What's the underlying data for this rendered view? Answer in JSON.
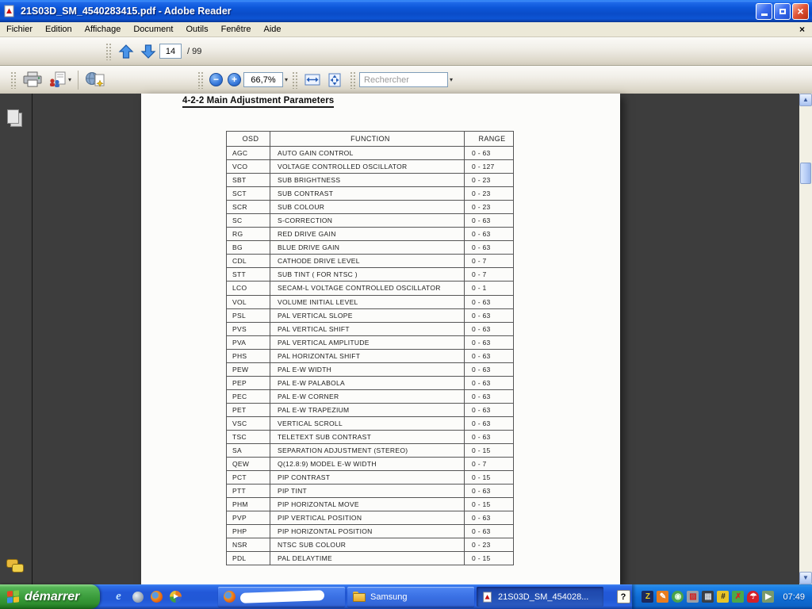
{
  "window": {
    "title": "21S03D_SM_4540283415.pdf - Adobe Reader"
  },
  "menu": {
    "items": [
      "Fichier",
      "Edition",
      "Affichage",
      "Document",
      "Outils",
      "Fenêtre",
      "Aide"
    ]
  },
  "toolbar": {
    "page_number": "14",
    "page_count_label": "/ 99",
    "zoom_level": "66,7%",
    "search_placeholder": "Rechercher"
  },
  "icons": {
    "titlebar": [
      "adobe-reader",
      "minimize",
      "restore",
      "close"
    ],
    "toolbar": [
      "page-up",
      "page-down",
      "print",
      "email-share",
      "create-pdf-online",
      "zoom-out",
      "zoom-in",
      "fit-width",
      "fit-page",
      "search"
    ],
    "nav_panel": [
      "pages",
      "comments"
    ],
    "quick_launch": [
      "internet-explorer",
      "messenger",
      "firefox",
      "media-player"
    ],
    "tray": [
      "zonealarm",
      "writing-tool",
      "badge",
      "shield",
      "display",
      "utility",
      "network-users",
      "avira-antivirus",
      "pointer"
    ]
  },
  "document": {
    "section_title": "4-2-2 Main Adjustment Parameters",
    "table": {
      "headers": [
        "OSD",
        "FUNCTION",
        "RANGE"
      ],
      "rows": [
        [
          "AGC",
          "AUTO GAIN CONTROL",
          "0 - 63"
        ],
        [
          "VCO",
          "VOLTAGE CONTROLLED OSCILLATOR",
          "0 - 127"
        ],
        [
          "SBT",
          "SUB BRIGHTNESS",
          "0 - 23"
        ],
        [
          "SCT",
          "SUB CONTRAST",
          "0 - 23"
        ],
        [
          "SCR",
          "SUB COLOUR",
          "0 - 23"
        ],
        [
          "SC",
          "S-CORRECTION",
          "0 - 63"
        ],
        [
          "RG",
          "RED DRIVE GAIN",
          "0 - 63"
        ],
        [
          "BG",
          "BLUE DRIVE GAIN",
          "0 - 63"
        ],
        [
          "CDL",
          "CATHODE DRIVE LEVEL",
          "0 - 7"
        ],
        [
          "STT",
          "SUB TINT ( FOR NTSC )",
          "0 - 7"
        ],
        [
          "LCO",
          "SECAM-L VOLTAGE CONTROLLED OSCILLATOR",
          "0 - 1"
        ],
        [
          "VOL",
          "VOLUME INITIAL LEVEL",
          "0 - 63"
        ],
        [
          "PSL",
          "PAL VERTICAL SLOPE",
          "0 - 63"
        ],
        [
          "PVS",
          "PAL VERTICAL SHIFT",
          "0 - 63"
        ],
        [
          "PVA",
          "PAL VERTICAL AMPLITUDE",
          "0 - 63"
        ],
        [
          "PHS",
          "PAL HORIZONTAL SHIFT",
          "0 - 63"
        ],
        [
          "PEW",
          "PAL E-W WIDTH",
          "0 - 63"
        ],
        [
          "PEP",
          "PAL E-W PALABOLA",
          "0 - 63"
        ],
        [
          "PEC",
          "PAL E-W CORNER",
          "0 - 63"
        ],
        [
          "PET",
          "PAL E-W TRAPEZIUM",
          "0 - 63"
        ],
        [
          "VSC",
          "VERTICAL SCROLL",
          "0 - 63"
        ],
        [
          "TSC",
          "TELETEXT SUB CONTRAST",
          "0 - 63"
        ],
        [
          "SA",
          "SEPARATION ADJUSTMENT (STEREO)",
          "0 - 15"
        ],
        [
          "QEW",
          "Q(12.8:9) MODEL E-W WIDTH",
          "0 - 7"
        ],
        [
          "PCT",
          "PIP CONTRAST",
          "0 - 15"
        ],
        [
          "PTT",
          "PIP TINT",
          "0 - 63"
        ],
        [
          "PHM",
          "PIP HORIZONTAL MOVE",
          "0 - 15"
        ],
        [
          "PVP",
          "PIP VERTICAL POSITION",
          "0 - 63"
        ],
        [
          "PHP",
          "PIP HORIZONTAL POSITION",
          "0 - 63"
        ],
        [
          "NSR",
          "NTSC SUB COLOUR",
          "0 - 23"
        ],
        [
          "PDL",
          "PAL DELAYTIME",
          "0 - 15"
        ]
      ]
    }
  },
  "taskbar": {
    "start_label": "démarrer",
    "window_buttons": [
      {
        "label": "",
        "icon": "firefox"
      },
      {
        "label": "Samsung",
        "icon": "folder"
      },
      {
        "label": "21S03D_SM_454028...",
        "icon": "pdf-document"
      }
    ],
    "clock": "07:49"
  },
  "colors": {
    "titlebar_blue": "#0c56d8",
    "taskbar_blue": "#2258d8",
    "start_green": "#3d9e3e",
    "document_background": "#3d3d3d",
    "toolbar_gray": "#ece8dc",
    "close_red": "#e2573a"
  }
}
